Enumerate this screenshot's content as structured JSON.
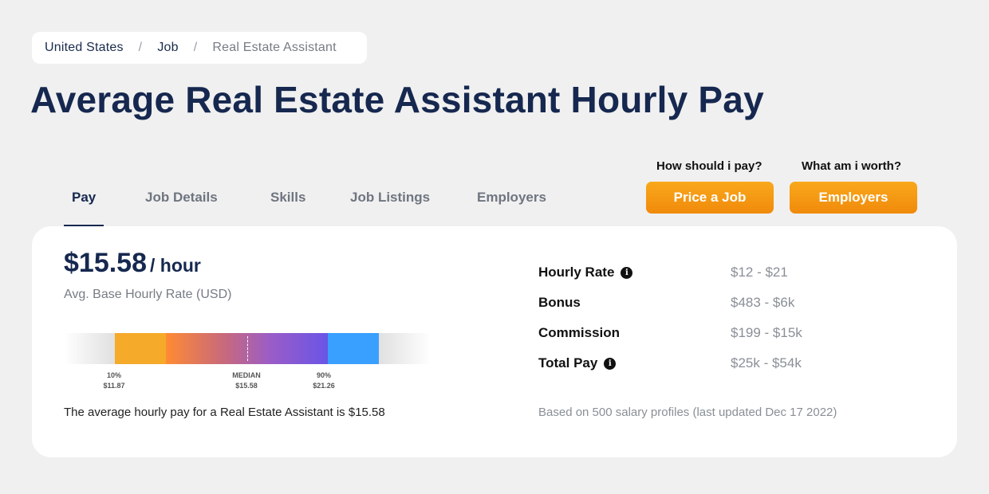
{
  "breadcrumb": {
    "items": [
      "United States",
      "Job",
      "Real Estate Assistant"
    ],
    "separator": "/"
  },
  "page_title": "Average Real Estate Assistant Hourly Pay",
  "tabs": [
    "Pay",
    "Job Details",
    "Skills",
    "Job Listings",
    "Employers"
  ],
  "active_tab": "Pay",
  "cta": {
    "price_label": "How should i pay?",
    "price_button": "Price a Job",
    "worth_label": "What am i worth?",
    "worth_button": "Employers"
  },
  "pay": {
    "amount": "$15.58",
    "unit": "/ hour",
    "caption": "Avg. Base Hourly Rate (USD)",
    "range": {
      "p10_label": "10%",
      "p10_value": "$11.87",
      "median_label": "MEDIAN",
      "median_value": "$15.58",
      "p90_label": "90%",
      "p90_value": "$21.26"
    },
    "sentence": "The average hourly pay for a Real Estate Assistant is $15.58"
  },
  "stats": [
    {
      "label": "Hourly Rate",
      "value": "$12 - $21",
      "info": true
    },
    {
      "label": "Bonus",
      "value": "$483 - $6k",
      "info": false
    },
    {
      "label": "Commission",
      "value": "$199 - $15k",
      "info": false
    },
    {
      "label": "Total Pay",
      "value": "$25k - $54k",
      "info": true
    }
  ],
  "footnote": "Based on 500 salary profiles (last updated Dec 17 2022)",
  "colors": {
    "navy": "#16284f",
    "orange": "#f5aa2a",
    "button": "#f08a0b",
    "blue": "#3aa0ff",
    "purple": "#6a55e6"
  },
  "icons": {
    "info": "info-icon"
  }
}
